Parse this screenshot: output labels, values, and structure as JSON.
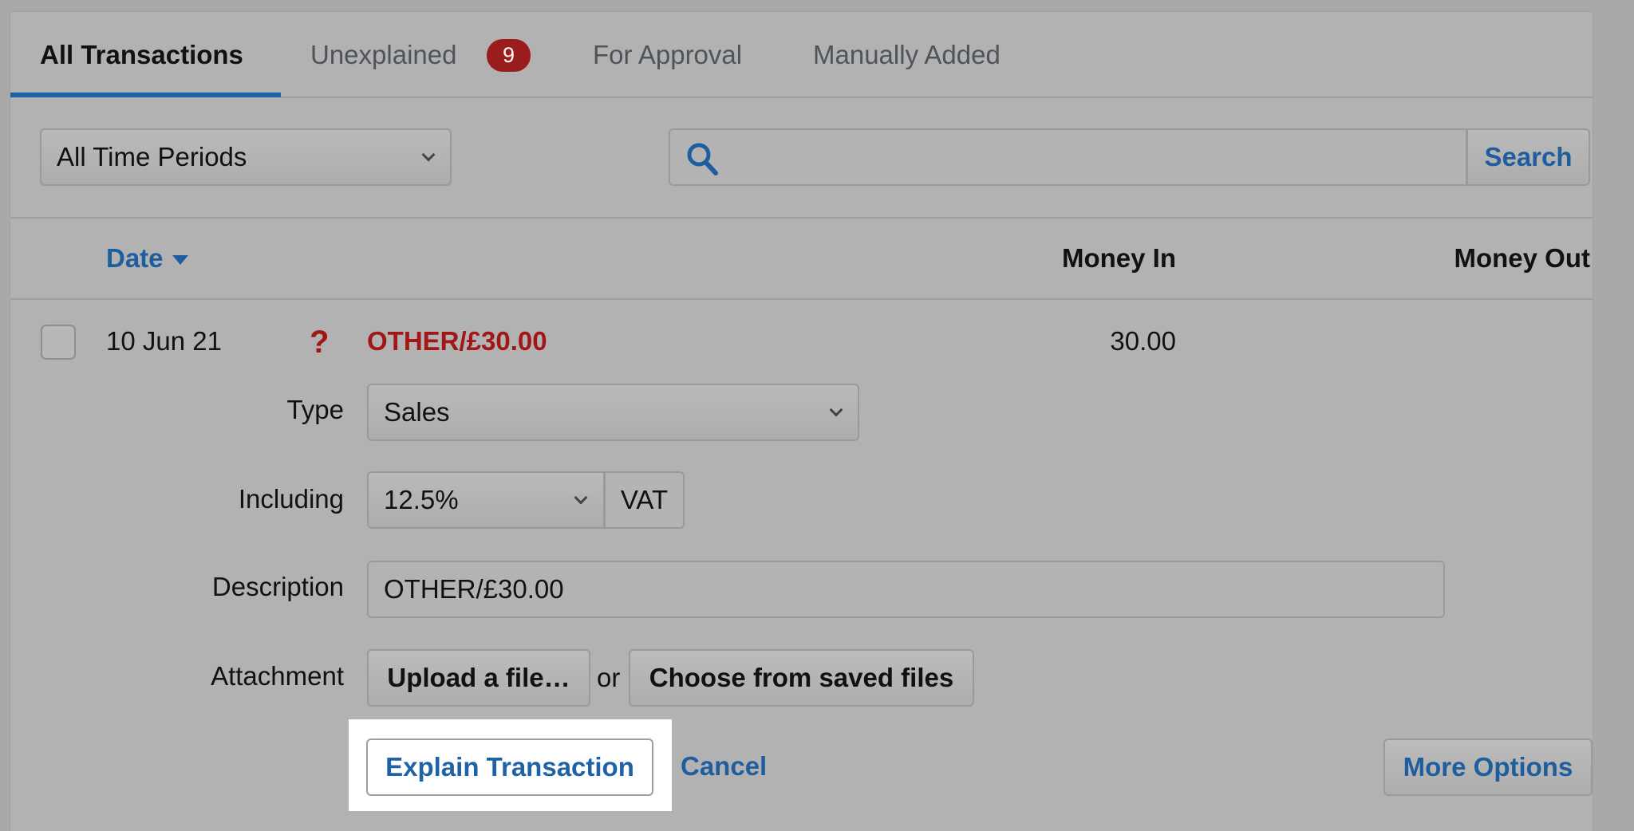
{
  "tabs": [
    {
      "label": "All Transactions"
    },
    {
      "label": "Unexplained",
      "badge": "9"
    },
    {
      "label": "For Approval"
    },
    {
      "label": "Manually Added"
    }
  ],
  "filters": {
    "period": "All Time Periods",
    "search_value": "",
    "search_button": "Search"
  },
  "columns": {
    "date": "Date",
    "money_in": "Money In",
    "money_out": "Money Out"
  },
  "transaction": {
    "date": "10 Jun 21",
    "status_icon": "question-mark-icon",
    "title": "OTHER/£30.00",
    "money_in": "30.00",
    "money_out": ""
  },
  "form": {
    "type_label": "Type",
    "type_value": "Sales",
    "including_label": "Including",
    "vat_rate": "12.5%",
    "vat_addon": "VAT",
    "description_label": "Description",
    "description_value": "OTHER/£30.00",
    "attachment_label": "Attachment",
    "upload_button": "Upload a file…",
    "or_text": "or",
    "choose_button": "Choose from saved files"
  },
  "actions": {
    "explain": "Explain Transaction",
    "cancel": "Cancel",
    "more": "More Options"
  },
  "colors": {
    "accent": "#1f62a6",
    "alert": "#a31616",
    "highlight": "#ffffff"
  }
}
